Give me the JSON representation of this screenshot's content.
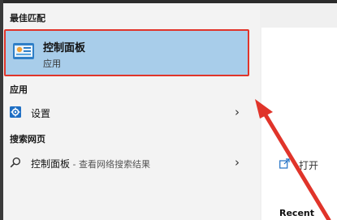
{
  "sections": {
    "best_match_header": "最佳匹配",
    "apps_header": "应用",
    "web_header": "搜索网页"
  },
  "best_match": {
    "title": "控制面板",
    "subtitle": "应用",
    "icon": "control-panel-icon"
  },
  "apps": [
    {
      "label": "设置",
      "icon": "settings-gear-icon"
    }
  ],
  "web_result": {
    "label": "控制面板",
    "suffix": " - 查看网络搜索结果",
    "icon": "search-icon"
  },
  "right_panel": {
    "open_label": "打开",
    "recent_label": "Recent"
  },
  "colors": {
    "selected_bg": "#a8cdea",
    "highlight_border": "#e0342a",
    "annotation_arrow": "#e0342a"
  }
}
